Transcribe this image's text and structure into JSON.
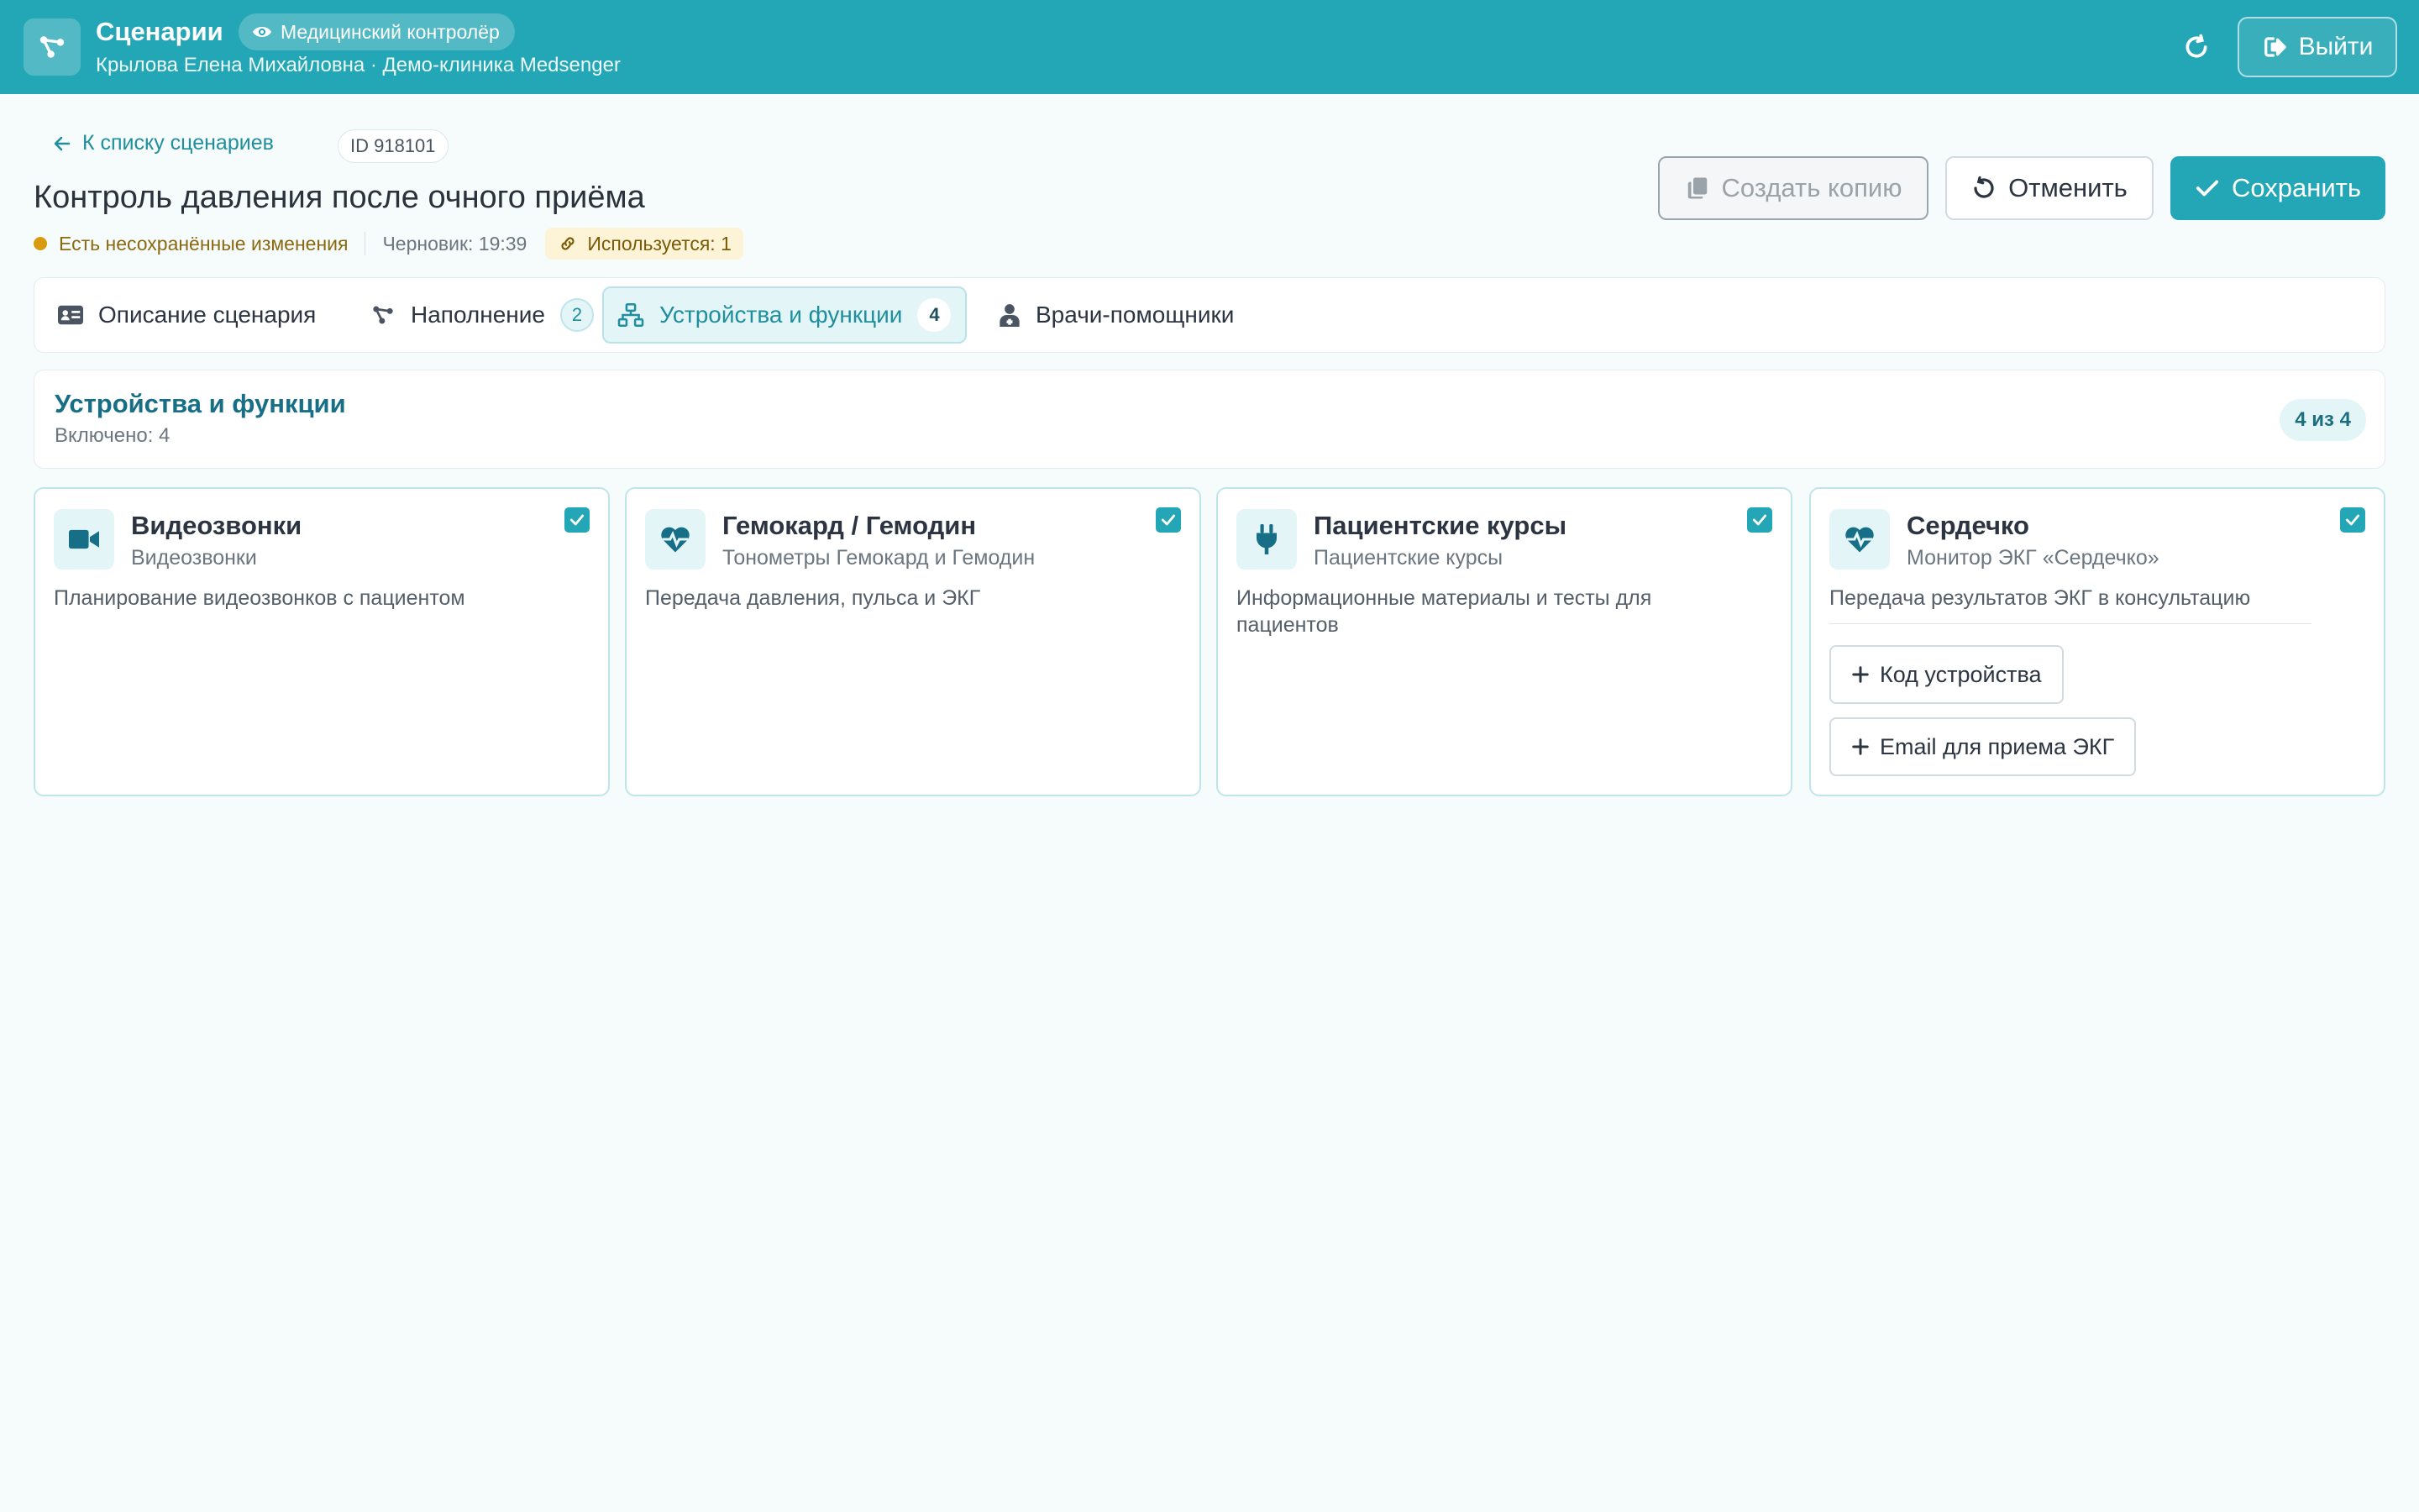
{
  "header": {
    "title": "Сценарии",
    "role": "Медицинский контролёр",
    "user_line": "Крылова Елена Михайловна · Демо-клиника Medsenger",
    "logout_label": "Выйти"
  },
  "page": {
    "back_label": "К списку сценариев",
    "id_label": "ID 918101",
    "title": "Контроль давления после очного приёма",
    "unsaved_label": "Есть несохранённые изменения",
    "draft_label": "Черновик: 19:39",
    "usage_label": "Используется: 1",
    "actions": {
      "copy_label": "Создать копию",
      "cancel_label": "Отменить",
      "save_label": "Сохранить"
    }
  },
  "tabs": [
    {
      "label": "Описание сценария"
    },
    {
      "label": "Наполнение",
      "count": "2"
    },
    {
      "label": "Устройства и функции",
      "count": "4"
    },
    {
      "label": "Врачи-помощники"
    }
  ],
  "section": {
    "title": "Устройства и функции",
    "subtitle": "Включено: 4",
    "count_label": "4 из 4"
  },
  "cards": [
    {
      "title": "Видеозвонки",
      "subtitle": "Видеозвонки",
      "description": "Планирование видеозвонков с пациентом",
      "icon": "video-camera-icon",
      "checked": true
    },
    {
      "title": "Гемокард / Гемодин",
      "subtitle": "Тонометры Гемокард и Гемодин",
      "description": "Передача давления, пульса и ЭКГ",
      "icon": "heart-pulse-icon",
      "checked": true
    },
    {
      "title": "Пациентские курсы",
      "subtitle": "Пациентские курсы",
      "description": "Информационные материалы и тесты для пациентов",
      "icon": "plug-icon",
      "checked": true
    },
    {
      "title": "Сердечко",
      "subtitle": "Монитор ЭКГ «Сердечко»",
      "description": "Передача результатов ЭКГ в консультацию",
      "icon": "heart-pulse-icon",
      "checked": true,
      "buttons": [
        "Код устройства",
        "Email для приема ЭКГ"
      ]
    }
  ],
  "colors": {
    "accent": "#23a6b5",
    "accent_dark": "#166f86",
    "warning": "#d89b10",
    "background": "#f6fbfc"
  }
}
